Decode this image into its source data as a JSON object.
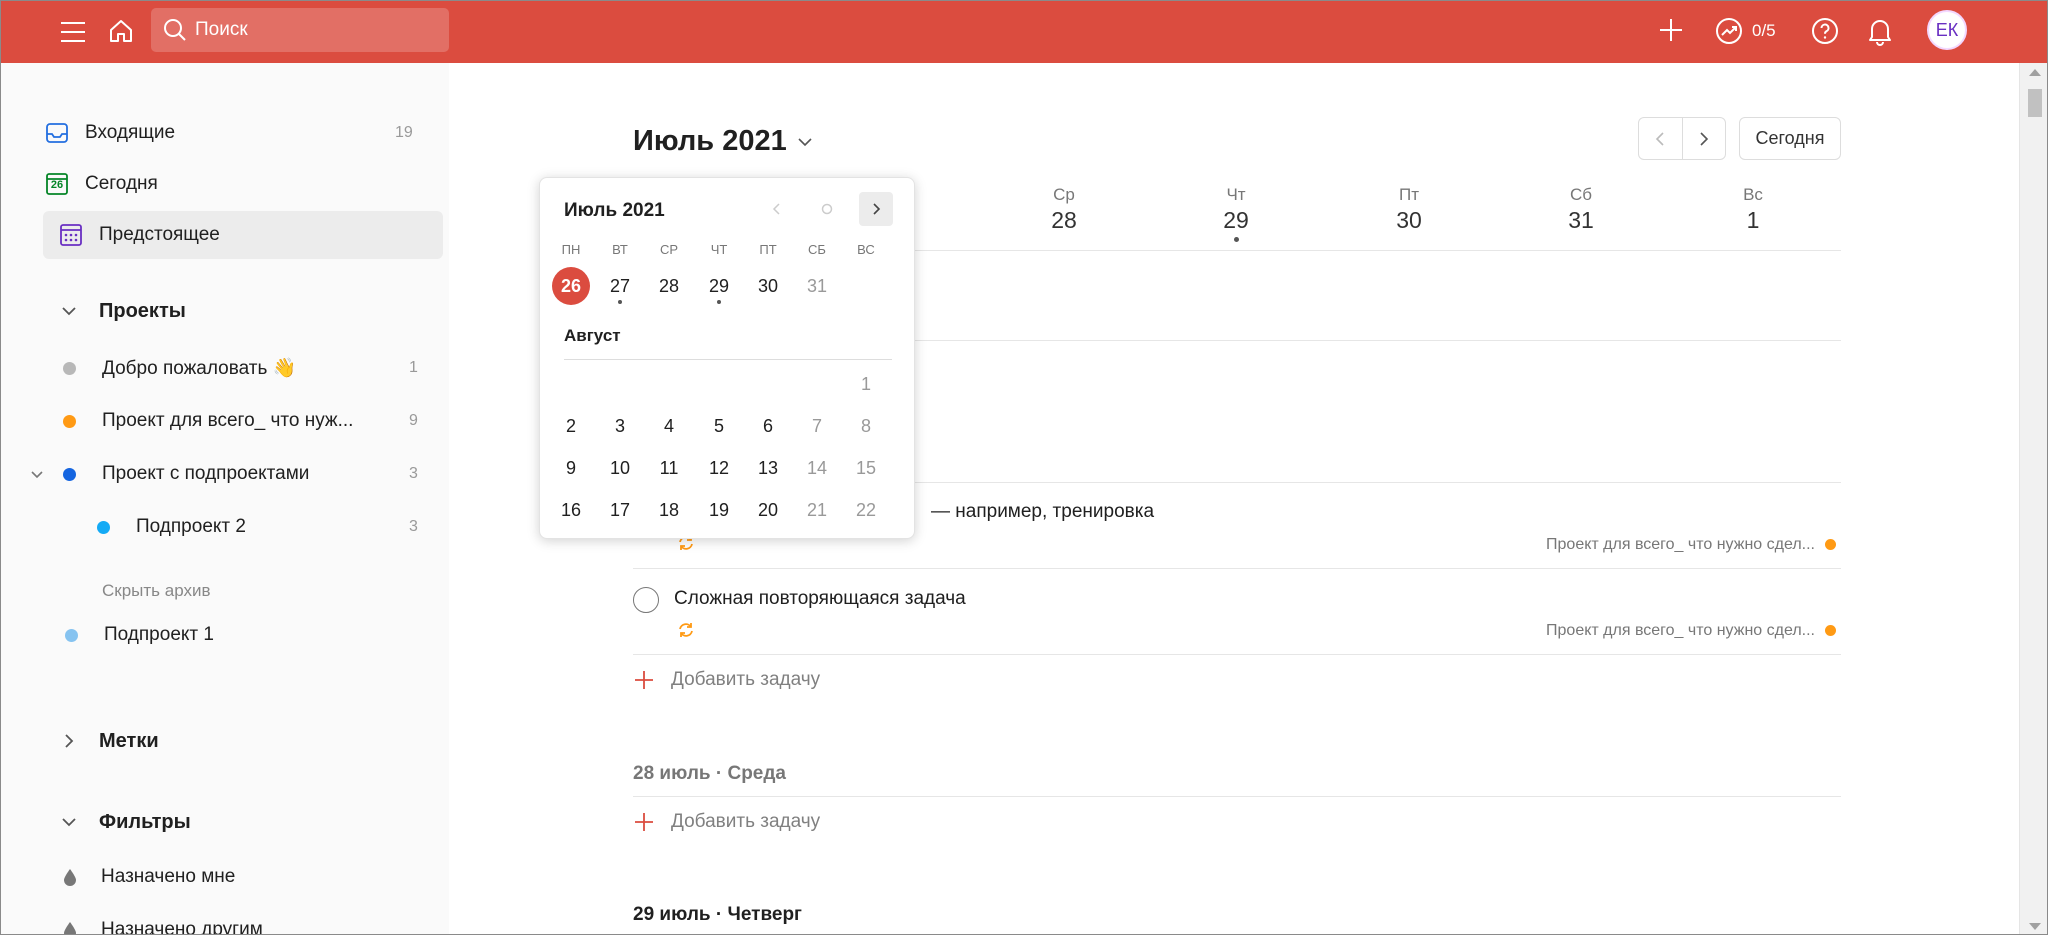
{
  "topbar": {
    "search_placeholder": "Поиск",
    "karma": "0/5",
    "avatar_initials": "ЕК",
    "accent_color": "#db4c3f"
  },
  "sidebar": {
    "inbox": {
      "label": "Входящие",
      "count": "19"
    },
    "today": {
      "label": "Сегодня",
      "icon_day": "26"
    },
    "upcoming": {
      "label": "Предстоящее"
    },
    "projects_header": "Проекты",
    "projects": [
      {
        "label": "Добро пожаловать 👋",
        "count": "1",
        "color": "#b8b8b8"
      },
      {
        "label": "Проект для всего_ что нуж...",
        "count": "9",
        "color": "#ff9a14"
      },
      {
        "label": "Проект с подпроектами",
        "count": "3",
        "color": "#1565e0"
      },
      {
        "label": "Подпроект 2",
        "count": "3",
        "color": "#14aaf5"
      }
    ],
    "archive_toggle": "Скрыть архив",
    "archived": [
      {
        "label": "Подпроект 1",
        "color": "#86c3f0"
      }
    ],
    "labels_header": "Метки",
    "filters_header": "Фильтры",
    "filters": [
      {
        "label": "Назначено мне"
      },
      {
        "label": "Назначено другим"
      }
    ]
  },
  "main": {
    "month_title": "Июль 2021",
    "today_button": "Сегодня",
    "weekdays": [
      {
        "wd": "Ср",
        "dn": "28"
      },
      {
        "wd": "Чт",
        "dn": "29"
      },
      {
        "wd": "Пт",
        "dn": "30"
      },
      {
        "wd": "Сб",
        "dn": "31"
      },
      {
        "wd": "Вс",
        "dn": "1"
      }
    ],
    "tasks": [
      {
        "text": "— например, тренировка",
        "project": "Проект для всего_ что нужно сдел..."
      },
      {
        "text": "Сложная повторяющаяся задача",
        "project": "Проект для всего_ что нужно сдел..."
      }
    ],
    "add_task": "Добавить задачу",
    "sections": [
      "28 июль · Среда",
      "29 июль · Четверг"
    ]
  },
  "picker": {
    "title": "Июль 2021",
    "dow": [
      "ПН",
      "ВТ",
      "СР",
      "ЧТ",
      "ПТ",
      "СБ",
      "ВС"
    ],
    "july_days": [
      "26",
      "27",
      "28",
      "29",
      "30",
      "31"
    ],
    "august_label": "Август",
    "august_rows": [
      [
        "",
        "",
        "",
        "",
        "",
        "",
        "1"
      ],
      [
        "2",
        "3",
        "4",
        "5",
        "6",
        "7",
        "8"
      ],
      [
        "9",
        "10",
        "11",
        "12",
        "13",
        "14",
        "15"
      ],
      [
        "16",
        "17",
        "18",
        "19",
        "20",
        "21",
        "22"
      ]
    ]
  }
}
